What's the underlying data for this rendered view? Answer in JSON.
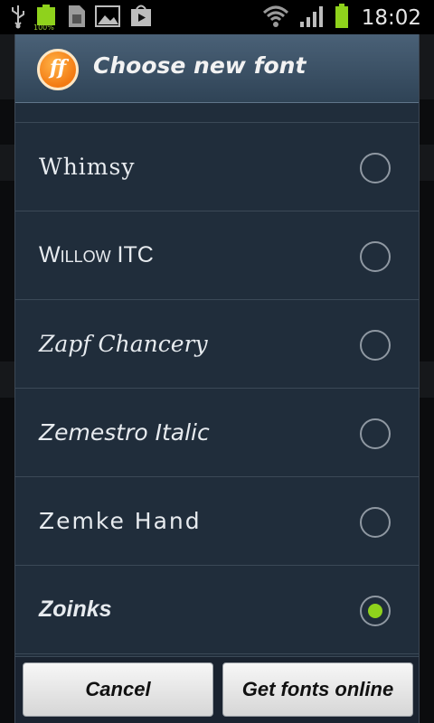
{
  "status_bar": {
    "time": "18:02",
    "battery_percent_label": "100%",
    "icons": [
      "usb-icon",
      "battery-full-icon",
      "sd-card-icon",
      "gallery-icon",
      "play-store-icon",
      "wifi-icon",
      "signal-icon",
      "battery-icon"
    ]
  },
  "dialog": {
    "title": "Choose new font",
    "logo_text": "ff",
    "fonts": [
      {
        "label": "Whimsy",
        "selected": false
      },
      {
        "label": "Willow ITC",
        "selected": false
      },
      {
        "label": "Zapf Chancery",
        "selected": false
      },
      {
        "label": "Zemestro Italic",
        "selected": false
      },
      {
        "label": "Zemke Hand",
        "selected": false
      },
      {
        "label": "Zoinks",
        "selected": true
      }
    ],
    "buttons": {
      "cancel": "Cancel",
      "get_fonts_online": "Get fonts online"
    }
  },
  "colors": {
    "dialog_bg": "#202d3b",
    "header_bg": "#3d5266",
    "radio_selected": "#8fd21c",
    "battery_green": "#8fd21c"
  }
}
